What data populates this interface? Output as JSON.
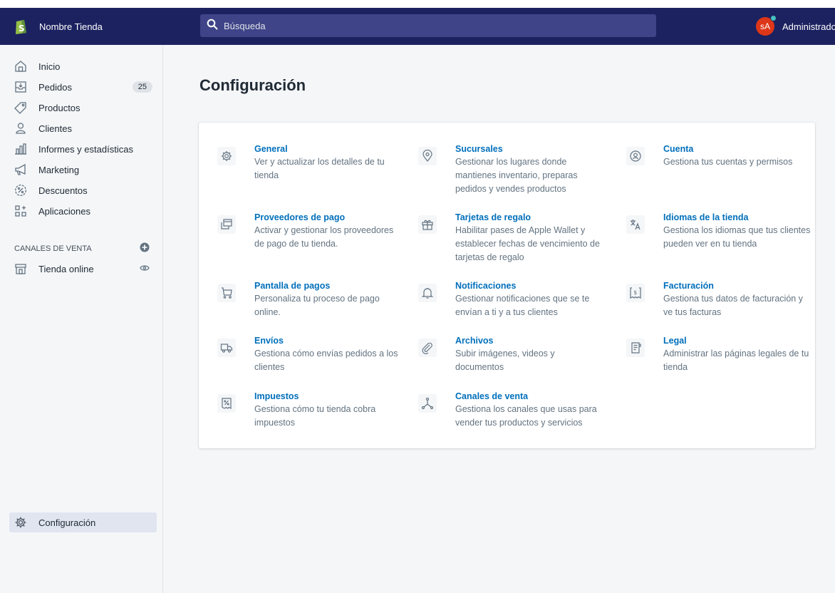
{
  "header": {
    "store_name": "Nombre Tienda",
    "search_placeholder": "Búsqueda",
    "avatar_initials": "sA",
    "user_name": "Administrador"
  },
  "sidebar": {
    "items": [
      {
        "label": "Inicio",
        "icon": "home-icon"
      },
      {
        "label": "Pedidos",
        "icon": "orders-icon",
        "badge": "25"
      },
      {
        "label": "Productos",
        "icon": "tag-icon"
      },
      {
        "label": "Clientes",
        "icon": "customer-icon"
      },
      {
        "label": "Informes y estadísticas",
        "icon": "analytics-icon"
      },
      {
        "label": "Marketing",
        "icon": "marketing-icon"
      },
      {
        "label": "Descuentos",
        "icon": "discount-icon"
      },
      {
        "label": "Aplicaciones",
        "icon": "apps-icon"
      }
    ],
    "channels_title": "CANALES DE VENTA",
    "channels": [
      {
        "label": "Tienda online",
        "icon": "store-icon"
      }
    ],
    "settings_label": "Configuración"
  },
  "main": {
    "title": "Configuración",
    "tiles": [
      {
        "title": "General",
        "description": "Ver y actualizar los detalles de tu tienda",
        "icon": "gear-icon"
      },
      {
        "title": "Sucursales",
        "description": "Gestionar los lugares donde mantienes inventario, preparas pedidos y vendes productos",
        "icon": "location-icon"
      },
      {
        "title": "Cuenta",
        "description": "Gestiona tus cuentas y permisos",
        "icon": "account-icon"
      },
      {
        "title": "Proveedores de pago",
        "description": "Activar y gestionar los proveedores de pago de tu tienda.",
        "icon": "payment-icon"
      },
      {
        "title": "Tarjetas de regalo",
        "description": "Habilitar pases de Apple Wallet y establecer fechas de vencimiento de tarjetas de regalo",
        "icon": "gift-icon"
      },
      {
        "title": "Idiomas de la tienda",
        "description": "Gestiona los idiomas que tus clientes pueden ver en tu tienda",
        "icon": "language-icon"
      },
      {
        "title": "Pantalla de pagos",
        "description": "Personaliza tu proceso de pago online.",
        "icon": "cart-icon"
      },
      {
        "title": "Notificaciones",
        "description": "Gestionar notificaciones que se te envían a ti y a tus clientes",
        "icon": "bell-icon"
      },
      {
        "title": "Facturación",
        "description": "Gestiona tus datos de facturación y ve tus facturas",
        "icon": "billing-icon"
      },
      {
        "title": "Envíos",
        "description": "Gestiona cómo envías pedidos a los clientes",
        "icon": "truck-icon"
      },
      {
        "title": "Archivos",
        "description": "Subir imágenes, videos y documentos",
        "icon": "paperclip-icon"
      },
      {
        "title": "Legal",
        "description": "Administrar las páginas legales de tu tienda",
        "icon": "legal-icon"
      },
      {
        "title": "Impuestos",
        "description": "Gestiona cómo tu tienda cobra impuestos",
        "icon": "tax-icon"
      },
      {
        "title": "Canales de venta",
        "description": "Gestiona los canales que usas para vender tus productos y servicios",
        "icon": "channels-icon"
      }
    ]
  },
  "colors": {
    "topbar": "#1c2260",
    "search_bg": "#3f4489",
    "link": "#006fbb",
    "avatar": "#de3618",
    "notify_dot": "#47c1bf"
  }
}
